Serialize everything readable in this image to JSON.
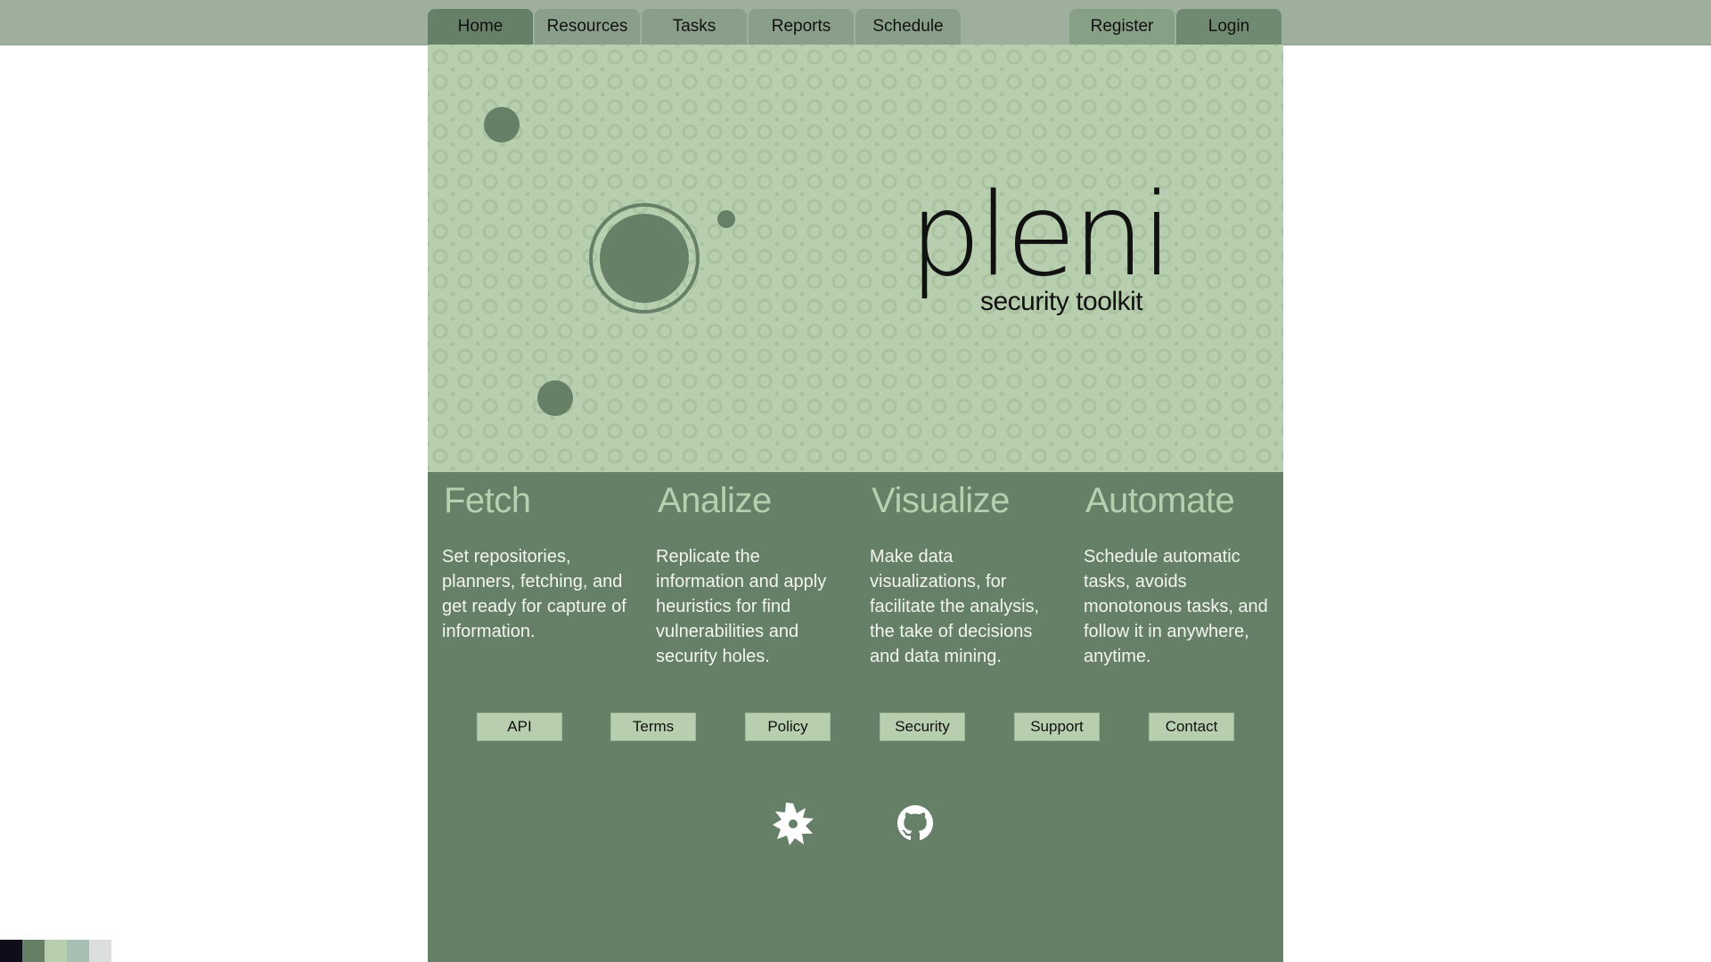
{
  "nav": {
    "tabs": [
      {
        "label": "Home"
      },
      {
        "label": "Resources"
      },
      {
        "label": "Tasks"
      },
      {
        "label": "Reports"
      },
      {
        "label": "Schedule"
      }
    ],
    "auth": [
      {
        "label": "Register"
      },
      {
        "label": "Login"
      }
    ]
  },
  "hero": {
    "logo_word": "pleni",
    "tagline": "security toolkit"
  },
  "features": [
    {
      "title": "Fetch",
      "text": "Set repositories, planners, fetching, and get ready for capture of information."
    },
    {
      "title": "Analize",
      "text": "Replicate the information and apply heuristics for find vulnerabilities and security holes."
    },
    {
      "title": "Visualize",
      "text": "Make data visualizations, for facilitate the analysis, the take of decisions and data mining."
    },
    {
      "title": "Automate",
      "text": "Schedule automatic tasks, avoids monotonous tasks, and follow it in anywhere, anytime."
    }
  ],
  "footer_links": [
    {
      "label": "API"
    },
    {
      "label": "Terms"
    },
    {
      "label": "Policy"
    },
    {
      "label": "Security"
    },
    {
      "label": "Support"
    },
    {
      "label": "Contact"
    }
  ],
  "social": [
    {
      "icon": "star-badge-icon"
    },
    {
      "icon": "github-icon"
    }
  ],
  "palette": [
    "#0f0d1c",
    "#658066",
    "#b7cfaf",
    "#a7bfb3",
    "#dcdedb"
  ]
}
